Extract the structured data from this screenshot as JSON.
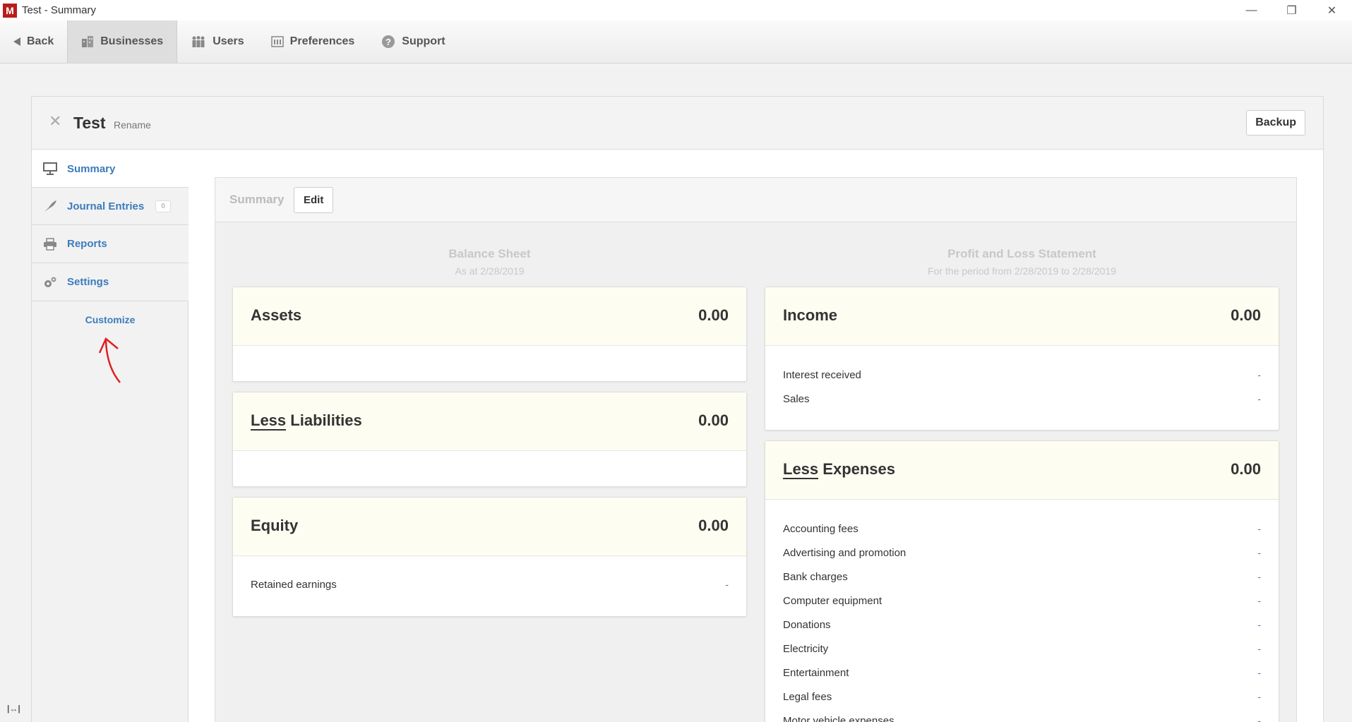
{
  "window": {
    "icon_letter": "M",
    "title": "Test - Summary",
    "minimize": "—",
    "restore": "❐",
    "close": "✕"
  },
  "toolbar": {
    "back": "Back",
    "businesses": "Businesses",
    "users": "Users",
    "preferences": "Preferences",
    "support": "Support"
  },
  "business": {
    "close": "✕",
    "name": "Test",
    "rename": "Rename",
    "backup": "Backup"
  },
  "sidebar": {
    "items": [
      {
        "label": "Summary"
      },
      {
        "label": "Journal Entries",
        "badge": "0"
      },
      {
        "label": "Reports"
      },
      {
        "label": "Settings"
      }
    ],
    "customize": "Customize",
    "bottom_icon": "|↔|"
  },
  "summary": {
    "label": "Summary",
    "edit": "Edit"
  },
  "balance_sheet": {
    "title": "Balance Sheet",
    "subtitle": "As at 2/28/2019",
    "assets": {
      "title": "Assets",
      "total": "0.00"
    },
    "liabilities": {
      "less": "Less",
      "title": "Liabilities",
      "total": "0.00"
    },
    "equity": {
      "title": "Equity",
      "total": "0.00",
      "rows": [
        {
          "label": "Retained earnings",
          "value": "-"
        }
      ]
    }
  },
  "profit_loss": {
    "title": "Profit and Loss Statement",
    "subtitle": "For the period from 2/28/2019 to 2/28/2019",
    "income": {
      "title": "Income",
      "total": "0.00",
      "rows": [
        {
          "label": "Interest received",
          "value": "-"
        },
        {
          "label": "Sales",
          "value": "-"
        }
      ]
    },
    "expenses": {
      "less": "Less",
      "title": "Expenses",
      "total": "0.00",
      "rows": [
        {
          "label": "Accounting fees",
          "value": "-"
        },
        {
          "label": "Advertising and promotion",
          "value": "-"
        },
        {
          "label": "Bank charges",
          "value": "-"
        },
        {
          "label": "Computer equipment",
          "value": "-"
        },
        {
          "label": "Donations",
          "value": "-"
        },
        {
          "label": "Electricity",
          "value": "-"
        },
        {
          "label": "Entertainment",
          "value": "-"
        },
        {
          "label": "Legal fees",
          "value": "-"
        },
        {
          "label": "Motor vehicle expenses",
          "value": "-"
        }
      ]
    }
  },
  "colors": {
    "link": "#3b7cbc",
    "card_head": "#fdfdf1",
    "app_icon": "#b81d1d",
    "annotation_arrow": "#e02020"
  }
}
